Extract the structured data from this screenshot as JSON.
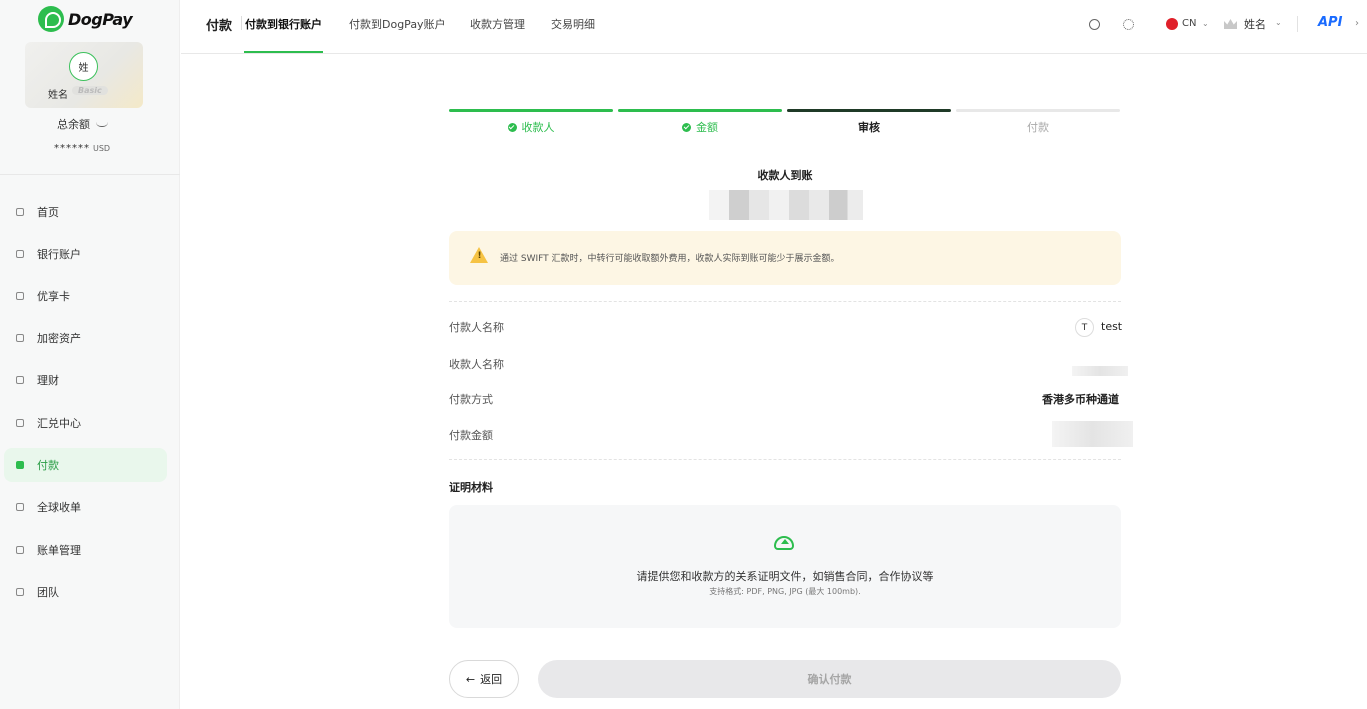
{
  "brand": {
    "name": "DogPay",
    "accent": "#2dbd4e"
  },
  "card": {
    "avatar_char": "姓",
    "name": "姓名",
    "tier": "Basic"
  },
  "balance": {
    "label": "总余额",
    "value": "******",
    "currency": "USD"
  },
  "menu": [
    {
      "label": "首页",
      "icon": "home-icon"
    },
    {
      "label": "银行账户",
      "icon": "bank-icon"
    },
    {
      "label": "优享卡",
      "icon": "card-icon"
    },
    {
      "label": "加密资产",
      "icon": "bitcoin-icon"
    },
    {
      "label": "理财",
      "icon": "wealth-icon"
    },
    {
      "label": "汇兑中心",
      "icon": "exchange-icon"
    },
    {
      "label": "付款",
      "icon": "payment-icon",
      "active": true
    },
    {
      "label": "全球收单",
      "icon": "acquiring-icon"
    },
    {
      "label": "账单管理",
      "icon": "bill-icon"
    },
    {
      "label": "团队",
      "icon": "team-icon"
    }
  ],
  "header": {
    "title": "付款",
    "tabs": [
      {
        "label": "付款到银行账户",
        "active": true
      },
      {
        "label": "付款到DogPay账户"
      },
      {
        "label": "收款方管理"
      },
      {
        "label": "交易明细"
      }
    ],
    "lang": "CN",
    "user": "姓名",
    "api": "API"
  },
  "steps": [
    {
      "label": "收款人",
      "state": "done"
    },
    {
      "label": "金额",
      "state": "done"
    },
    {
      "label": "审核",
      "state": "current"
    },
    {
      "label": "付款",
      "state": "pending"
    }
  ],
  "review": {
    "title": "收款人到账",
    "warning": "通过 SWIFT 汇款时，中转行可能收取额外费用，收款人实际到账可能少于展示金额。",
    "rows": {
      "payer_label": "付款人名称",
      "payer_initial": "T",
      "payer_value": "test",
      "payee_label": "收款人名称",
      "method_label": "付款方式",
      "method_value": "香港多币种通道",
      "amount_label": "付款金额"
    }
  },
  "proof": {
    "title": "证明材料",
    "main": "请提供您和收款方的关系证明文件，如销售合同，合作协议等",
    "sub": "支持格式: PDF, PNG, JPG (最大 100mb)."
  },
  "buttons": {
    "back": "返回",
    "confirm": "确认付款"
  }
}
